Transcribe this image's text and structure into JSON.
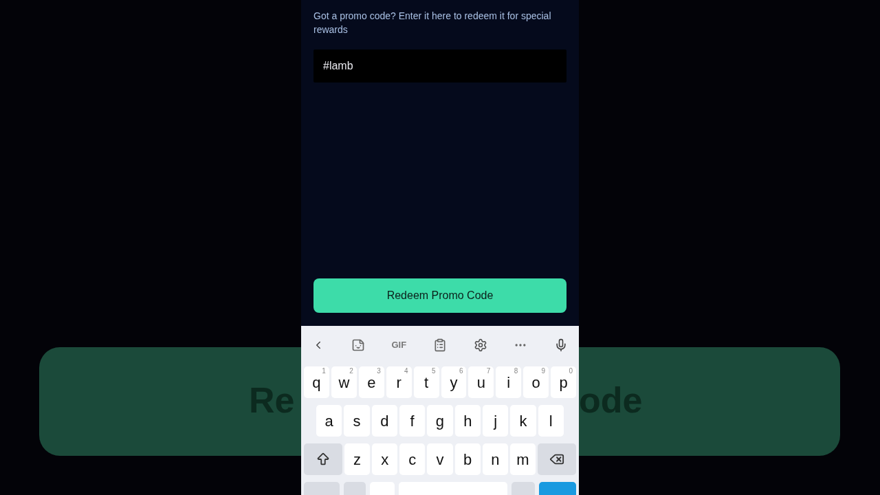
{
  "background": {
    "fragments": [
      "Re",
      "ode"
    ]
  },
  "intro": "Got a promo code? Enter it here to redeem it for special rewards",
  "promo_field": {
    "value": "#lamb"
  },
  "redeem_button": "Redeem Promo Code",
  "keyboard": {
    "toolbar_gif": "GIF",
    "row_1": [
      {
        "label": "q",
        "hint": "1"
      },
      {
        "label": "w",
        "hint": "2"
      },
      {
        "label": "e",
        "hint": "3"
      },
      {
        "label": "r",
        "hint": "4"
      },
      {
        "label": "t",
        "hint": "5"
      },
      {
        "label": "y",
        "hint": "6"
      },
      {
        "label": "u",
        "hint": "7"
      },
      {
        "label": "i",
        "hint": "8"
      },
      {
        "label": "o",
        "hint": "9"
      },
      {
        "label": "p",
        "hint": "0"
      }
    ],
    "row_2": [
      "a",
      "s",
      "d",
      "f",
      "g",
      "h",
      "j",
      "k",
      "l"
    ],
    "row_3": [
      "z",
      "x",
      "c",
      "v",
      "b",
      "n",
      "m"
    ]
  }
}
